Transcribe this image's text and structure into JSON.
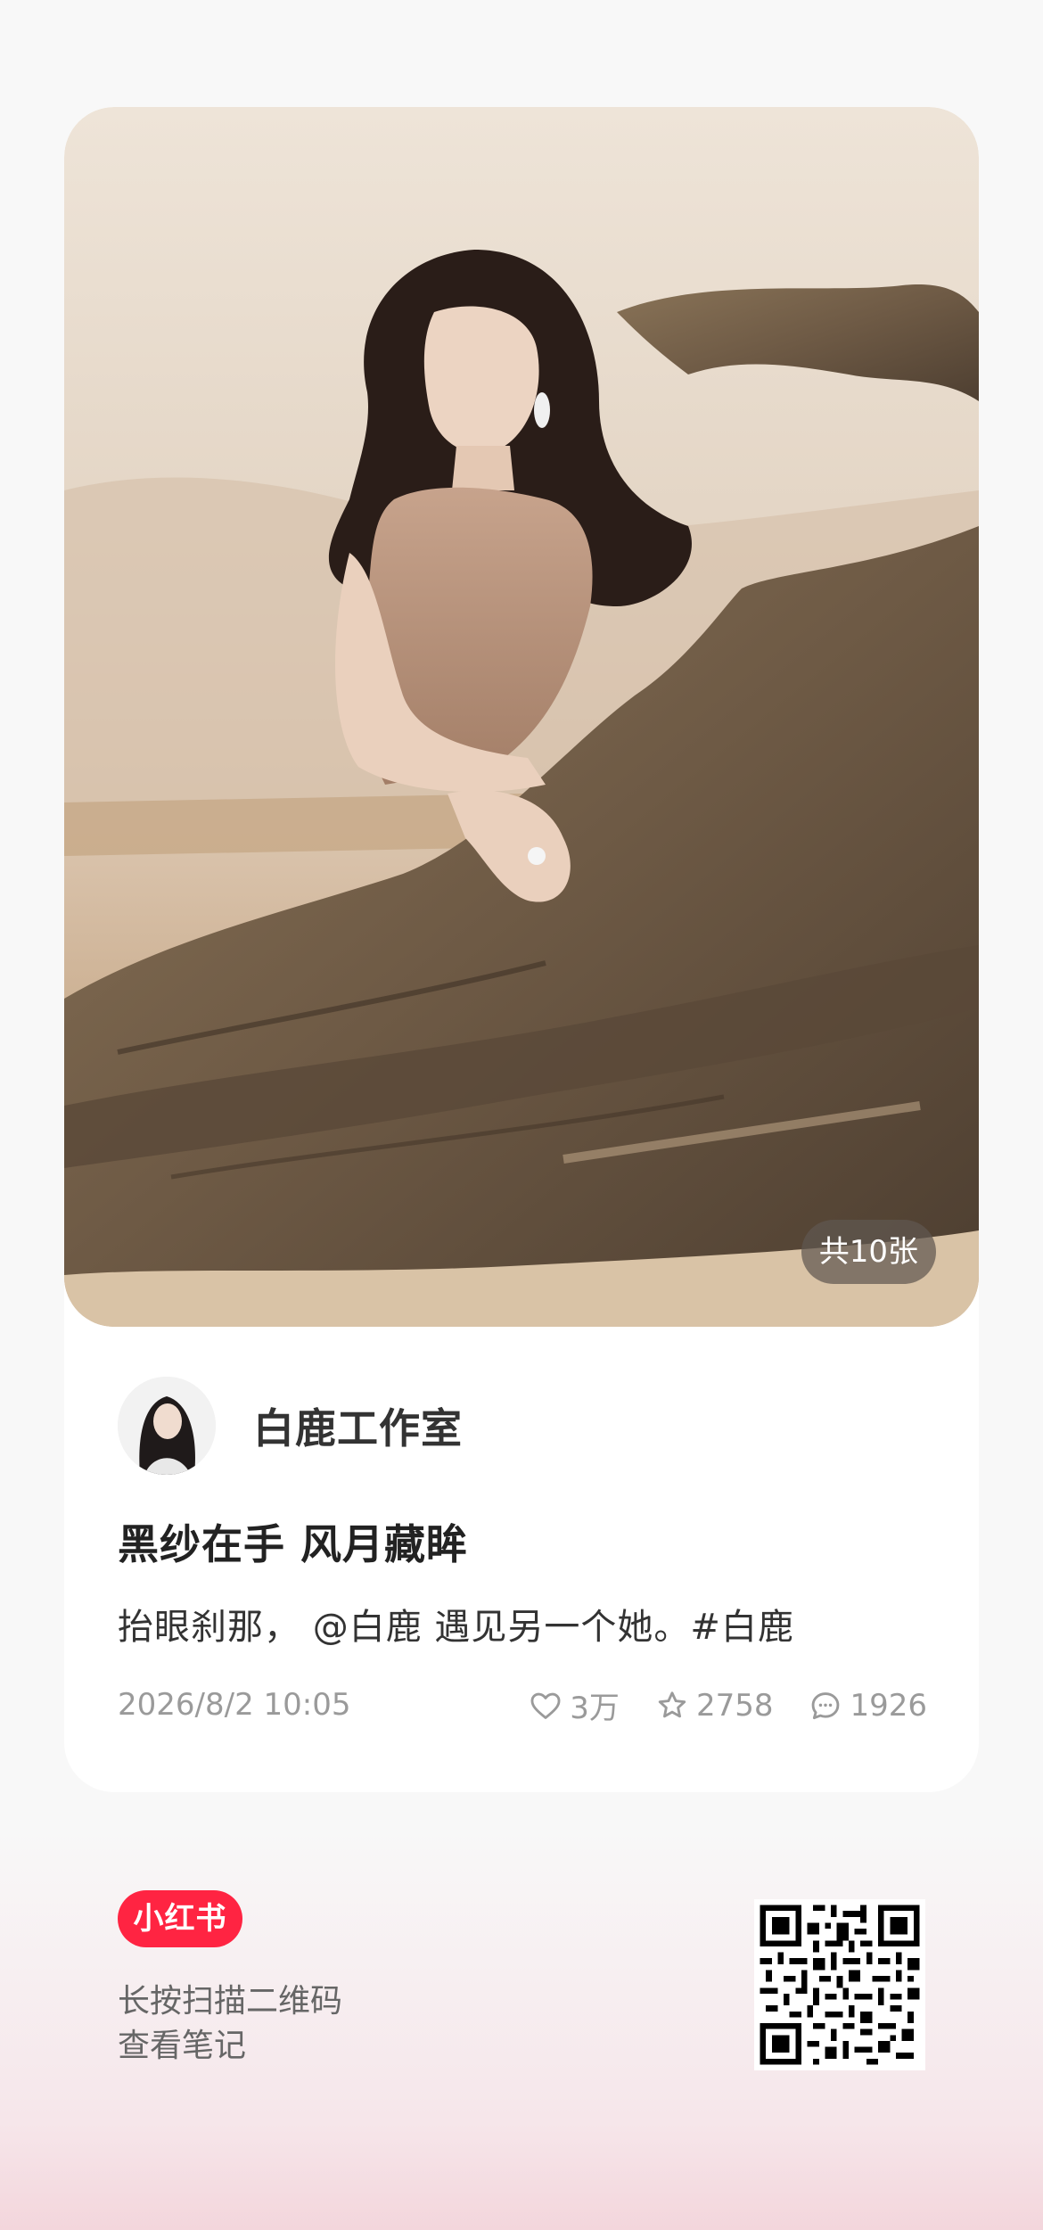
{
  "post": {
    "image_count": "共10张",
    "author": "白鹿工作室",
    "title": "黑纱在手 风月藏眸",
    "description": "抬眼刹那，  @白鹿 遇见另一个她。#白鹿",
    "date": "2026/8/2 10:05",
    "likes": "3万",
    "favorites": "2758",
    "comments": "1926"
  },
  "footer": {
    "logo": "小红书",
    "line1": "长按扫描二维码",
    "line2": "查看笔记"
  },
  "icons": {
    "like": "heart-icon",
    "favorite": "star-icon",
    "comment": "comment-bubble-icon"
  },
  "colors": {
    "brand": "#ff2442",
    "text_primary": "#222222",
    "text_secondary": "#9a9a9a"
  }
}
